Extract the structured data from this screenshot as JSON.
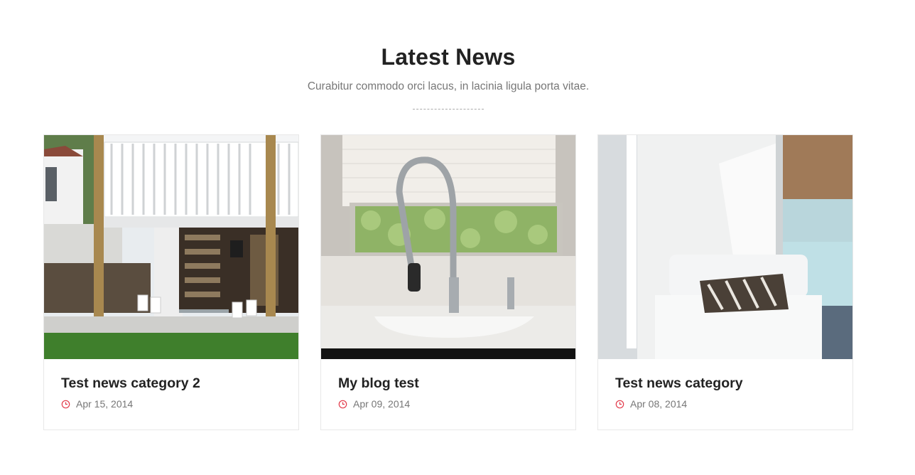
{
  "section": {
    "title": "Latest News",
    "subtitle": "Curabitur commodo orci lacus, in lacinia ligula porta vitae."
  },
  "colors": {
    "accent": "#e23b4b",
    "title": "#222222",
    "muted": "#777777"
  },
  "posts": [
    {
      "title": "Test news category 2",
      "date": "Apr 15, 2014",
      "image": "house-exterior-photo"
    },
    {
      "title": "My blog test",
      "date": "Apr 09, 2014",
      "image": "kitchen-faucet-photo"
    },
    {
      "title": "Test news category",
      "date": "Apr 08, 2014",
      "image": "daybed-lounge-photo"
    }
  ]
}
